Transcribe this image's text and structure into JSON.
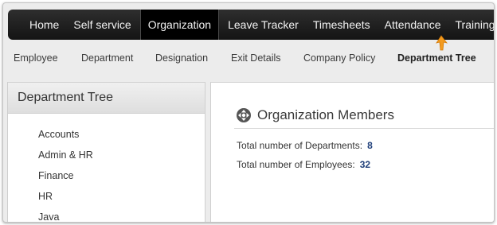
{
  "top_nav": {
    "tabs": [
      {
        "label": "Home"
      },
      {
        "label": "Self service"
      },
      {
        "label": "Organization"
      },
      {
        "label": "Leave Tracker"
      },
      {
        "label": "Timesheets"
      },
      {
        "label": "Attendance"
      },
      {
        "label": "Training"
      }
    ],
    "active_tab": "Organization"
  },
  "sub_nav": {
    "items": [
      {
        "label": "Employee"
      },
      {
        "label": "Department"
      },
      {
        "label": "Designation"
      },
      {
        "label": "Exit Details"
      },
      {
        "label": "Company Policy"
      },
      {
        "label": "Department Tree"
      }
    ],
    "active_item": "Department Tree"
  },
  "department_tree": {
    "title": "Department Tree",
    "items": [
      {
        "label": "Accounts"
      },
      {
        "label": "Admin & HR"
      },
      {
        "label": "Finance"
      },
      {
        "label": "HR"
      },
      {
        "label": "Java"
      }
    ]
  },
  "organization_members": {
    "title": "Organization Members",
    "icon": "move-arrows-icon",
    "stats": [
      {
        "label": "Total number of Departments:",
        "value": "8"
      },
      {
        "label": "Total number of Employees:",
        "value": "32"
      }
    ]
  },
  "colors": {
    "nav_bg": "#1a1a1a",
    "nav_active": "#000000",
    "accent_pointer": "#f39a1e",
    "stat_value": "#1f3f7a"
  }
}
